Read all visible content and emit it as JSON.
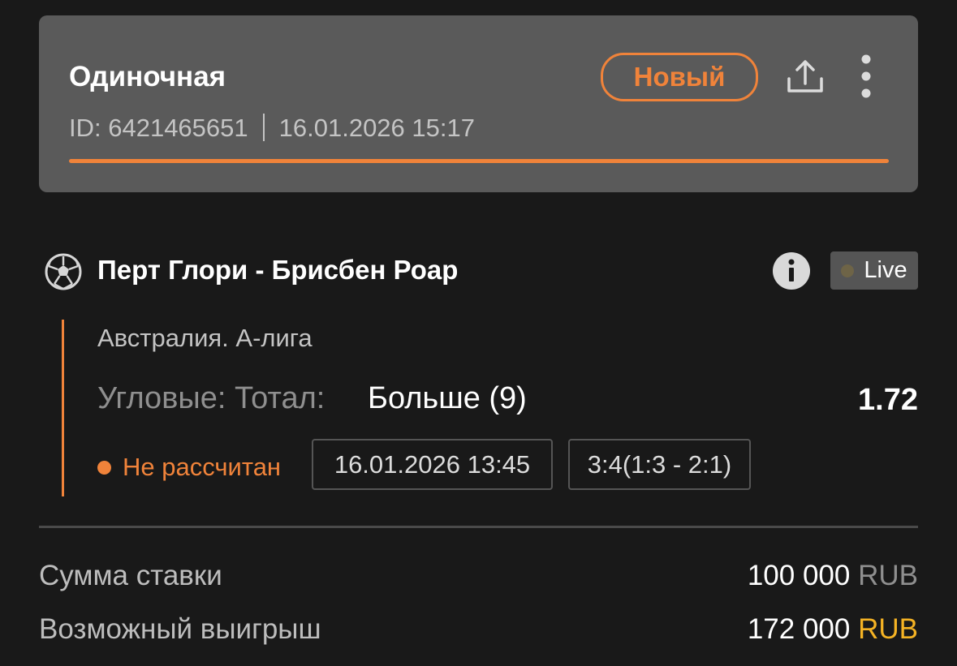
{
  "header": {
    "bet_type": "Одиночная",
    "id_text": "ID: 6421465651",
    "datetime": "16.01.2026 15:17",
    "status": "Новый",
    "share_icon": "share-icon",
    "more_icon": "more-vertical-icon",
    "accent_color": "#f0833a"
  },
  "event": {
    "sport_icon": "football-icon",
    "title": "Перт Глори - Брисбен Роар",
    "info_icon": "info-icon",
    "live_label": "Live",
    "league": "Австралия. А-лига",
    "market": "Угловые: Тотал:",
    "selection": "Больше (9)",
    "odds": "1.72",
    "settlement_status": "Не рассчитан",
    "event_datetime": "16.01.2026 13:45",
    "score": "3:4(1:3 - 2:1)"
  },
  "summary": {
    "stake_label": "Сумма ставки",
    "stake_amount": "100 000",
    "stake_currency": "RUB",
    "win_label": "Возможный выигрыш",
    "win_amount": "172 000",
    "win_currency": "RUB",
    "win_currency_color": "#f5b324"
  }
}
